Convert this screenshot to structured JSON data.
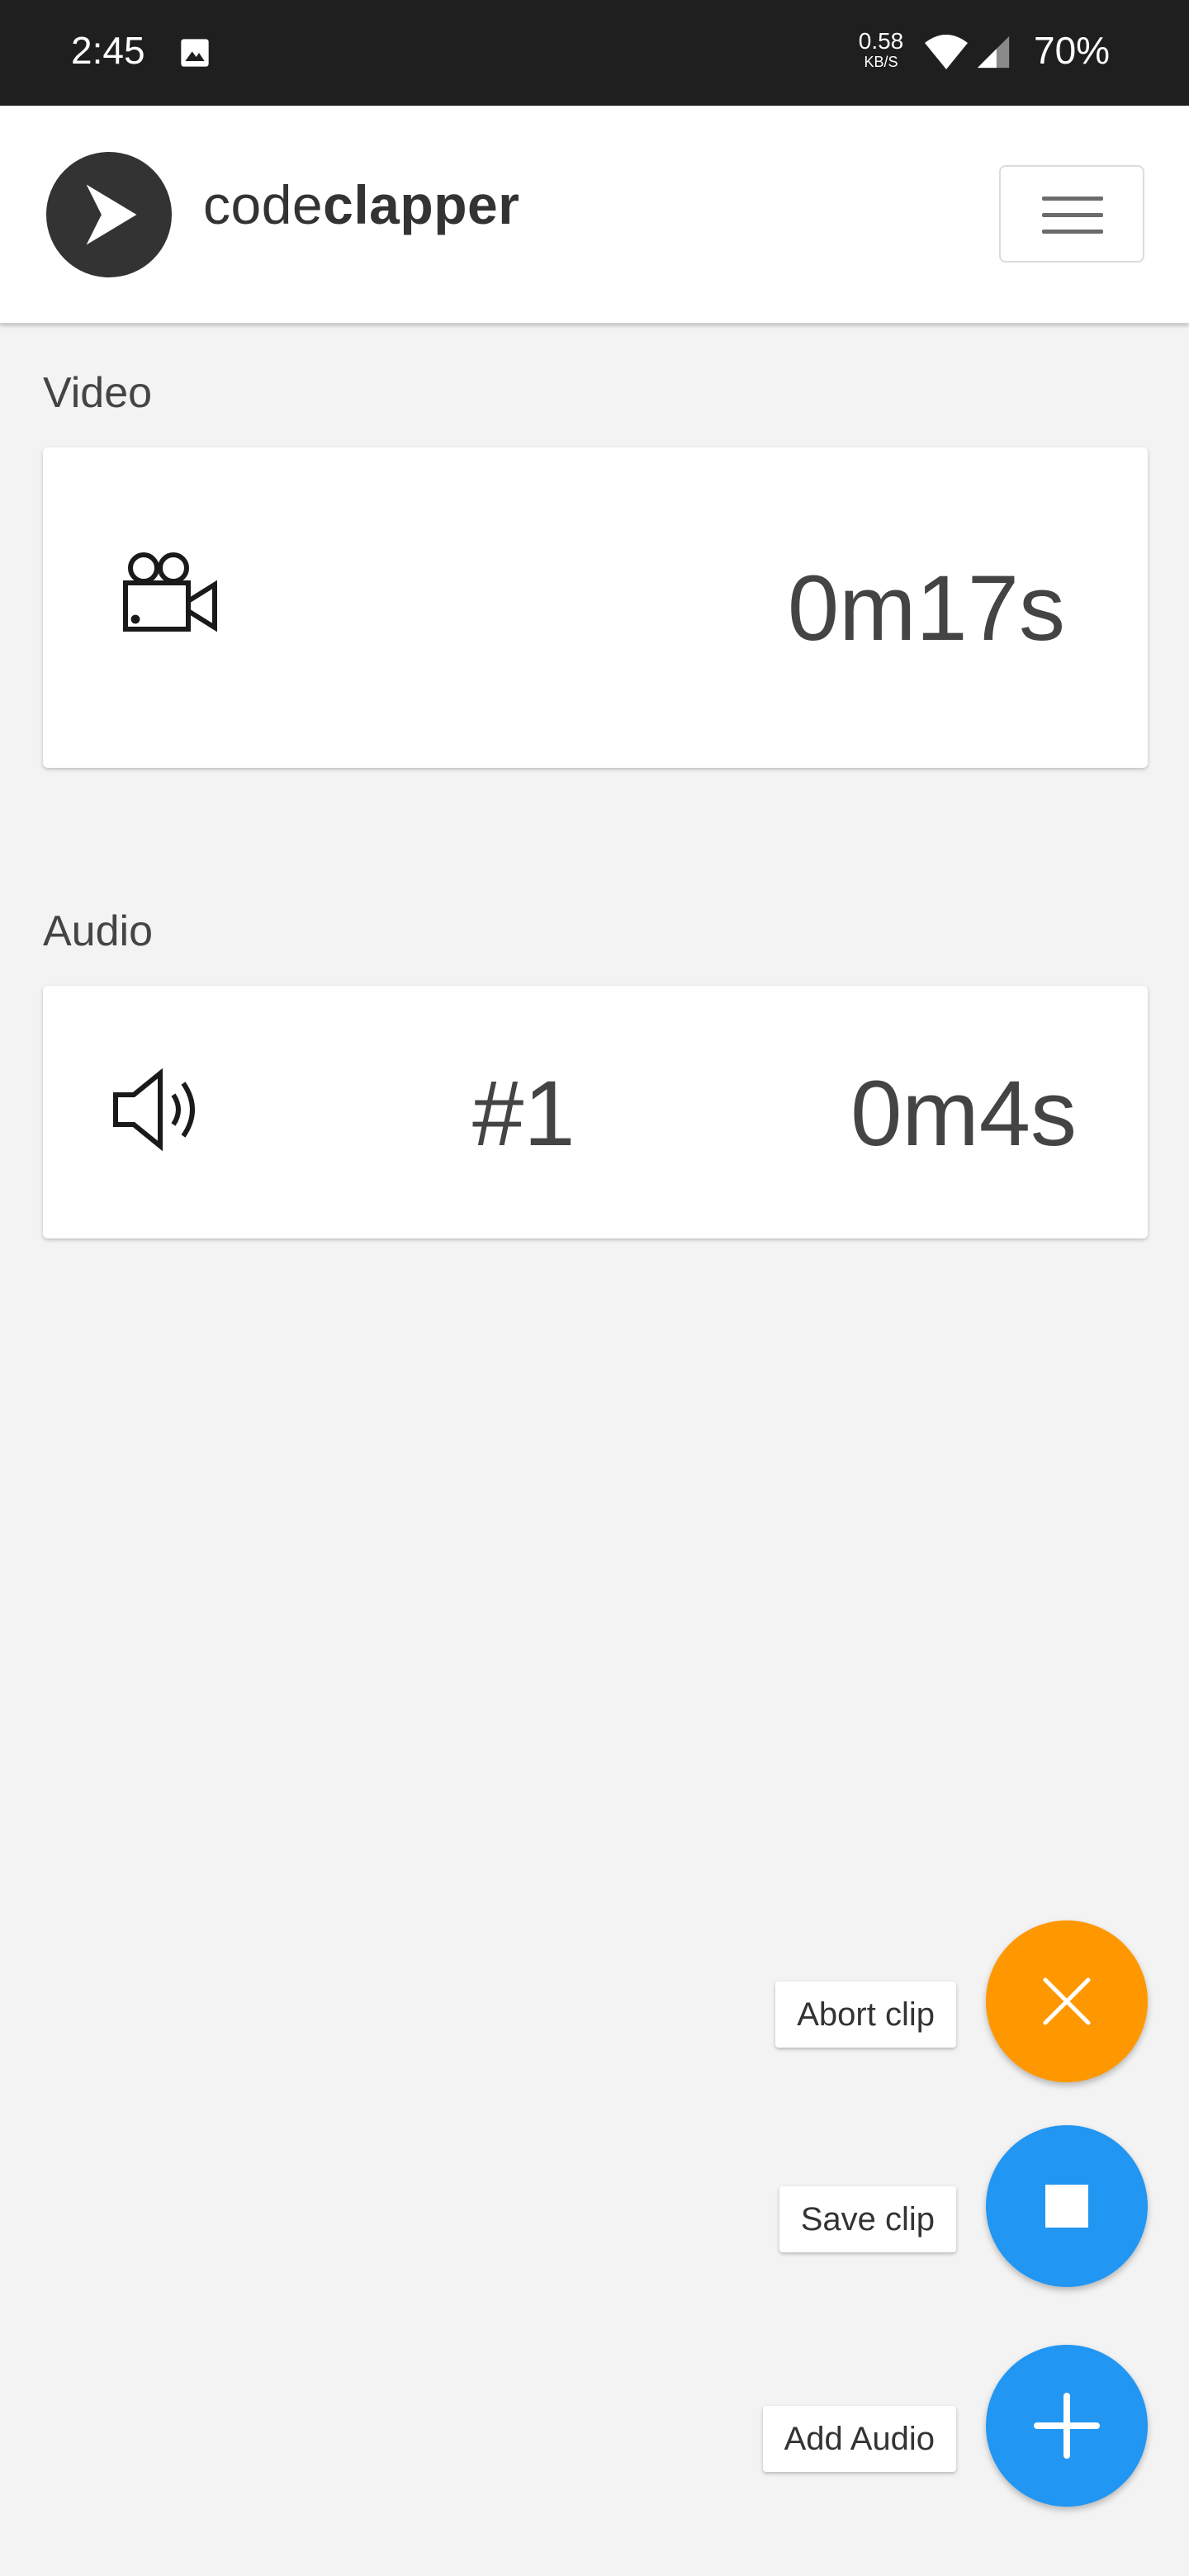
{
  "status_bar": {
    "time": "2:45",
    "net_rate": "0.58",
    "net_unit": "KB/S",
    "battery": "70%",
    "icons": [
      "gallery-icon",
      "wifi-icon",
      "signal-icon"
    ]
  },
  "header": {
    "brand_light": "code",
    "brand_bold": "clapper",
    "logo_icon": "play-logo-icon",
    "menu_icon": "hamburger-menu-icon"
  },
  "video": {
    "label": "Video",
    "icon": "video-camera-icon",
    "duration": "0m17s"
  },
  "audio": {
    "label": "Audio",
    "icon": "speaker-icon",
    "index": "#1",
    "duration": "0m4s"
  },
  "actions": {
    "abort_label": "Abort clip",
    "save_label": "Save clip",
    "add_audio_label": "Add Audio"
  },
  "colors": {
    "accent_orange": "#ff9800",
    "accent_blue": "#2196f3",
    "status_bar": "#1f1f1f",
    "background": "#f3f3f3"
  }
}
